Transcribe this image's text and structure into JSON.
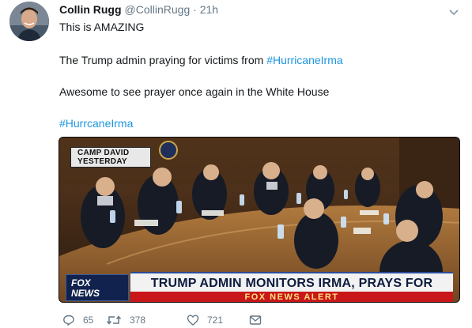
{
  "tweet": {
    "author": {
      "display_name": "Collin Rugg",
      "handle": "@CollinRugg",
      "separator": "·",
      "time": "21h"
    },
    "lines": [
      {
        "text": "This is AMAZING"
      },
      {
        "prefix": "The Trump admin praying for victims from ",
        "hashtag": "#HurricaneIrma"
      },
      {
        "text": "Awesome to see prayer once again in the White House"
      },
      {
        "hashtag": "#HurrcaneIrma"
      }
    ],
    "media": {
      "banner_line1": "CAMP DAVID",
      "banner_line2": "YESTERDAY",
      "network_logo_line1": "FOX",
      "network_logo_line2": "NEWS",
      "chyron": "TRUMP ADMIN MONITORS IRMA, PRAYS FOR VICTIMS",
      "alert": "FOX NEWS ALERT"
    },
    "actions": {
      "reply_count": "65",
      "retweet_count": "378",
      "like_count": "721"
    },
    "icons": [
      "caret-down-icon",
      "reply-icon",
      "retweet-icon",
      "heart-icon",
      "direct-message-icon"
    ],
    "colors": {
      "link": "#1b95e0",
      "muted": "#657786",
      "text": "#14171a"
    }
  }
}
